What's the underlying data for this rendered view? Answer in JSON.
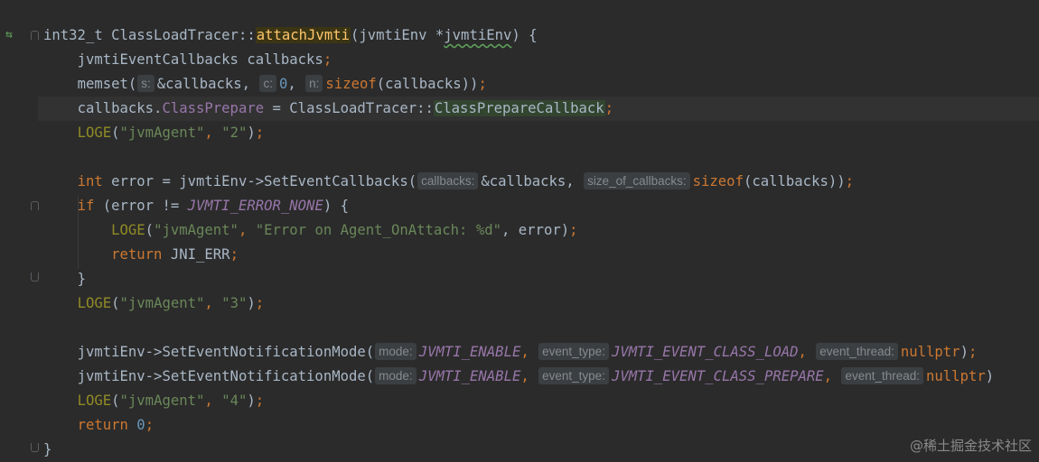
{
  "editor": {
    "signature": {
      "return_type": "int32_t",
      "class_name": "ClassLoadTracer",
      "scope_op": "::",
      "method_name": "attachJvmti",
      "open_paren": "(",
      "param_type": "jvmtiEnv",
      "pointer": " *",
      "param_name": "jvmtiEnv",
      "close": ") {"
    },
    "l2": {
      "text": "jvmtiEventCallbacks callbacks",
      "semi": ";"
    },
    "l3": {
      "fn": "memset(",
      "hint_s": "s:",
      "arg1": "&callbacks,",
      "hint_c": "c:",
      "arg2": "0",
      "comma": ",",
      "hint_n": "n:",
      "sizeof": "sizeof",
      "arg3": "(callbacks))",
      "semi": ";"
    },
    "l4": {
      "obj": "callbacks.",
      "field": "ClassPrepare",
      "assign": " = ClassLoadTracer::",
      "callback": "ClassPrepareCallback",
      "semi": ";"
    },
    "l5": {
      "macro": "LOGE",
      "open": "(",
      "tag": "\"jvmAgent\"",
      "sep": ", ",
      "msg": "\"2\"",
      "close": ")",
      "semi": ";"
    },
    "l6": {
      "kw": "int",
      "mid": " error = jvmtiEnv->SetEventCallbacks(",
      "hint1": "callbacks:",
      "arg1": "&callbacks,",
      "hint2": "size_of_callbacks:",
      "sizeof": "sizeof",
      "arg2": "(callbacks))",
      "semi": ";"
    },
    "l7": {
      "kw": "if",
      "mid": " (error != ",
      "const": "JVMTI_ERROR_NONE",
      "close": ") {"
    },
    "l8": {
      "macro": "LOGE",
      "open": "(",
      "tag": "\"jvmAgent\"",
      "sep": ", ",
      "msg": "\"Error on Agent_OnAttach: %d\"",
      "rest": ", error)",
      "semi": ";"
    },
    "l9": {
      "kw": "return",
      "val": " JNI_ERR",
      "semi": ";"
    },
    "l10": {
      "text": "}"
    },
    "l11": {
      "macro": "LOGE",
      "open": "(",
      "tag": "\"jvmAgent\"",
      "sep": ", ",
      "msg": "\"3\"",
      "close": ")",
      "semi": ";"
    },
    "l12": {
      "fn": "jvmtiEnv->SetEventNotificationMode(",
      "hint1": "mode:",
      "arg1": "JVMTI_ENABLE",
      "comma1": ",",
      "hint2": "event_type:",
      "arg2": "JVMTI_EVENT_CLASS_LOAD",
      "comma2": ",",
      "hint3": "event_thread:",
      "arg3": "nullptr",
      "close": ")",
      "semi": ";"
    },
    "l13": {
      "fn": "jvmtiEnv->SetEventNotificationMode(",
      "hint1": "mode:",
      "arg1": "JVMTI_ENABLE",
      "comma1": ",",
      "hint2": "event_type:",
      "arg2": "JVMTI_EVENT_CLASS_PREPARE",
      "comma2": ",",
      "hint3": "event_thread:",
      "arg3": "nullptr",
      "close": ")"
    },
    "l14": {
      "macro": "LOGE",
      "open": "(",
      "tag": "\"jvmAgent\"",
      "sep": ", ",
      "msg": "\"4\"",
      "close": ")",
      "semi": ";"
    },
    "l15": {
      "kw": "return",
      "val": "0",
      "semi": ";"
    },
    "l16": {
      "text": "}"
    }
  },
  "gutter": {
    "override_icon": "implementation-arrow-icon"
  },
  "watermark": "@稀土掘金技术社区",
  "colors": {
    "background": "#2b2b2b",
    "text": "#a9b7c6",
    "keyword": "#cc7832",
    "string": "#6a8759",
    "number": "#6897bb",
    "field": "#9876aa",
    "function": "#ffc66d",
    "macro": "#908b25"
  }
}
